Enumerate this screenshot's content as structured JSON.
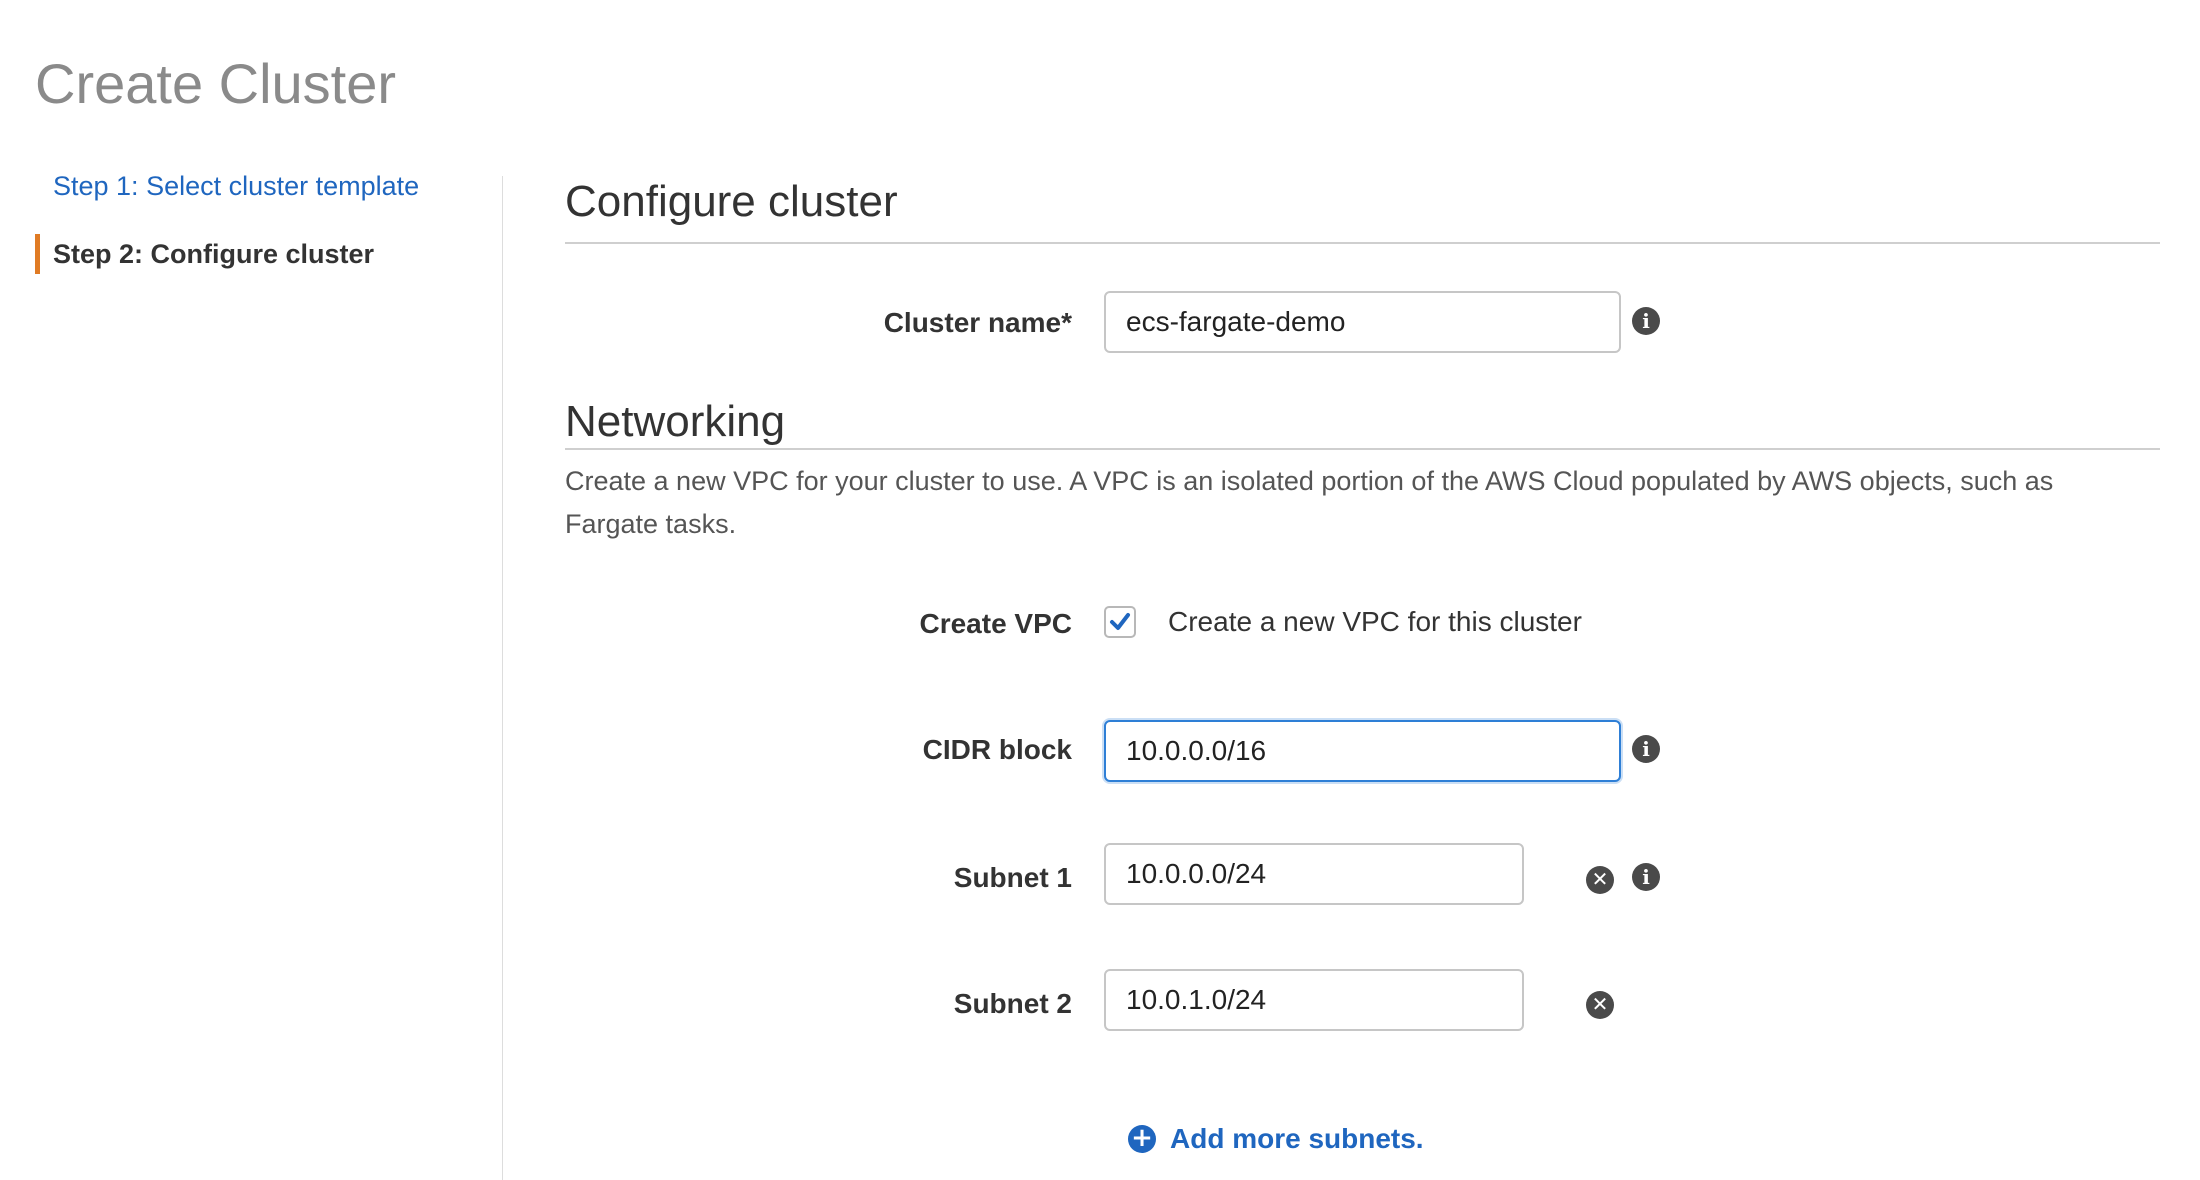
{
  "page": {
    "title": "Create Cluster"
  },
  "steps": [
    {
      "label": "Step 1: Select cluster template",
      "state": "link"
    },
    {
      "label": "Step 2: Configure cluster",
      "state": "active"
    }
  ],
  "configure": {
    "heading": "Configure cluster",
    "cluster_name": {
      "label": "Cluster name*",
      "value": "ecs-fargate-demo",
      "icon": "info-icon"
    }
  },
  "networking": {
    "heading": "Networking",
    "description": "Create a new VPC for your cluster to use. A VPC is an isolated portion of the AWS Cloud populated by AWS objects, such as Fargate tasks.",
    "create_vpc": {
      "label": "Create VPC",
      "checked": true,
      "checkbox_label": "Create a new VPC for this cluster"
    },
    "cidr_block": {
      "label": "CIDR block",
      "value": "10.0.0.0/16",
      "focused": true,
      "icon": "info-icon"
    },
    "subnets": [
      {
        "label": "Subnet 1",
        "value": "10.0.0.0/24",
        "icons": [
          "remove-icon",
          "info-icon"
        ]
      },
      {
        "label": "Subnet 2",
        "value": "10.0.1.0/24",
        "icons": [
          "remove-icon"
        ]
      }
    ],
    "add_more": {
      "label": "Add more subnets.",
      "icon": "plus-circle-icon"
    }
  },
  "colors": {
    "link": "#1f66bf",
    "active_step_bar": "#e07b24",
    "focus_border": "#2e7fd6",
    "checkmark": "#1f66bf"
  }
}
